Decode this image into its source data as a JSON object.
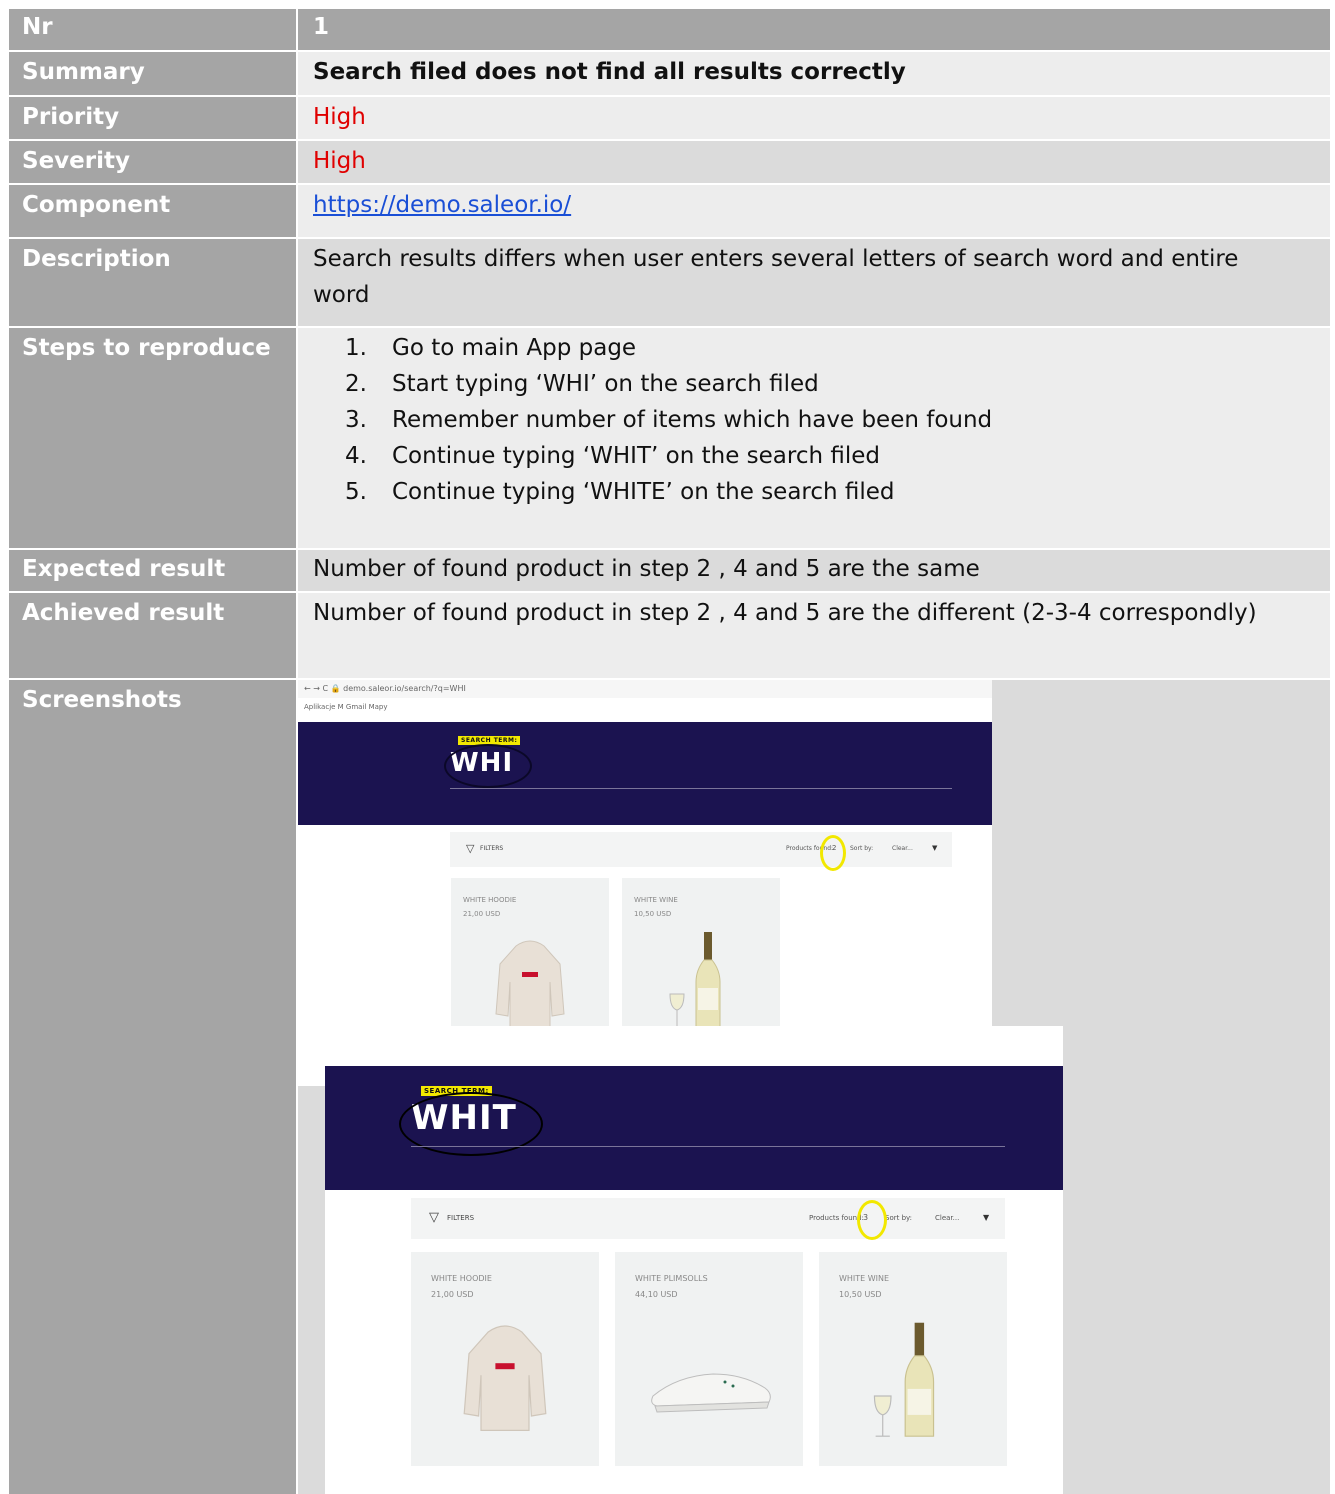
{
  "rows": {
    "nr": {
      "label": "Nr",
      "value": "1"
    },
    "summary": {
      "label": "Summary",
      "value": "Search filed does not find all results correctly"
    },
    "priority": {
      "label": "Priority",
      "value": "High"
    },
    "severity": {
      "label": "Severity",
      "value": "High"
    },
    "component": {
      "label": "Component",
      "value": "https://demo.saleor.io/"
    },
    "description": {
      "label": "Description",
      "value": "Search results differs when user enters several letters of search word and entire word"
    },
    "steps": {
      "label": "Steps to reproduce",
      "items": [
        {
          "num": "1.",
          "text": "Go to main App page"
        },
        {
          "num": "2.",
          "text": "Start typing ‘WHI’ on the search filed"
        },
        {
          "num": "3.",
          "text": "Remember number of items which have been found"
        },
        {
          "num": "4.",
          "text": "Continue typing ‘WHIT’ on the search filed"
        },
        {
          "num": "5.",
          "text": "Continue typing ‘WHITE’ on the search filed"
        }
      ]
    },
    "expected": {
      "label": "Expected result",
      "value": "Number of found product in step 2 , 4 and 5 are the same"
    },
    "achieved": {
      "label": "Achieved result",
      "value": "Number of found product in step 2 , 4 and 5 are the different (2-3-4 correspondly)"
    },
    "screenshots": {
      "label": "Screenshots"
    }
  },
  "shot1": {
    "url": "← → C   🔒 demo.saleor.io/search/?q=WHI",
    "bookmarks": "Aplikacje   M Gmail   Mapy",
    "badge": "SEARCH TERM:",
    "term": "WHI",
    "filters": "FILTERS",
    "found_label": "Products found:",
    "found_count": "2",
    "sort_label": "Sort by:",
    "sort_value": "Clear...",
    "products": [
      {
        "name": "WHITE HOODIE",
        "price": "21,00 USD"
      },
      {
        "name": "WHITE WINE",
        "price": "10,50 USD"
      }
    ]
  },
  "shot2": {
    "badge": "SEARCH TERM:",
    "term": "WHIT",
    "filters": "FILTERS",
    "found_label": "Products found:",
    "found_count": "3",
    "sort_label": "Sort by:",
    "sort_value": "Clear...",
    "products": [
      {
        "name": "WHITE HOODIE",
        "price": "21,00 USD"
      },
      {
        "name": "WHITE PLIMSOLLS",
        "price": "44,10 USD"
      },
      {
        "name": "WHITE WINE",
        "price": "10,50 USD"
      }
    ]
  },
  "colors": {
    "header": "#a5a5a5",
    "cell": "#dbdbdb",
    "cell_light": "#ededed",
    "priority": "#e00000",
    "link": "#1a4fd6",
    "hero": "#1b1350",
    "highlight": "#f2e800"
  }
}
